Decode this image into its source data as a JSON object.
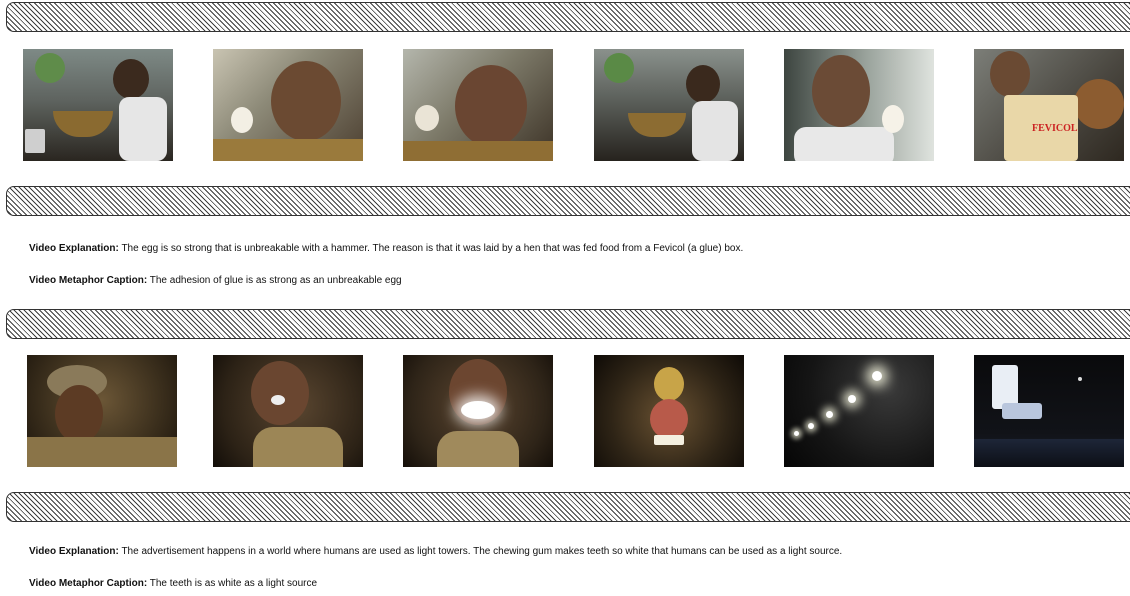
{
  "ad1": {
    "frames": [
      {
        "icon": "man-kitchen-frame"
      },
      {
        "icon": "man-egg-closeup-frame"
      },
      {
        "icon": "man-egg-closeup-frame"
      },
      {
        "icon": "man-kitchen-frame"
      },
      {
        "icon": "man-holding-egg-frame"
      },
      {
        "icon": "fevicol-box-frame",
        "product_text": "FEVICOL"
      }
    ],
    "explanation_label": "Video Explanation:",
    "explanation_text": " The egg is so strong that is unbreakable with a hammer. The reason is that it was laid by a hen that was fed food from a Fevicol (a glue) box.",
    "caption_label": "Video Metaphor Caption:",
    "caption_text": " The adhesion of glue is as strong as an unbreakable egg"
  },
  "ad2": {
    "frames": [
      {
        "icon": "turbaned-man-frame"
      },
      {
        "icon": "man-eating-gum-frame"
      },
      {
        "icon": "man-glowing-teeth-frame"
      },
      {
        "icon": "lamp-figure-frame"
      },
      {
        "icon": "light-towers-frame"
      },
      {
        "icon": "gum-pack-night-city-frame"
      }
    ],
    "explanation_label": "Video Explanation:",
    "explanation_text": " The advertisement happens in a world where humans are used as light towers. The chewing gum makes teeth so white that humans can be used as a light source.",
    "caption_label": "Video Metaphor Caption:",
    "caption_text": " The teeth is as white as a light source"
  }
}
